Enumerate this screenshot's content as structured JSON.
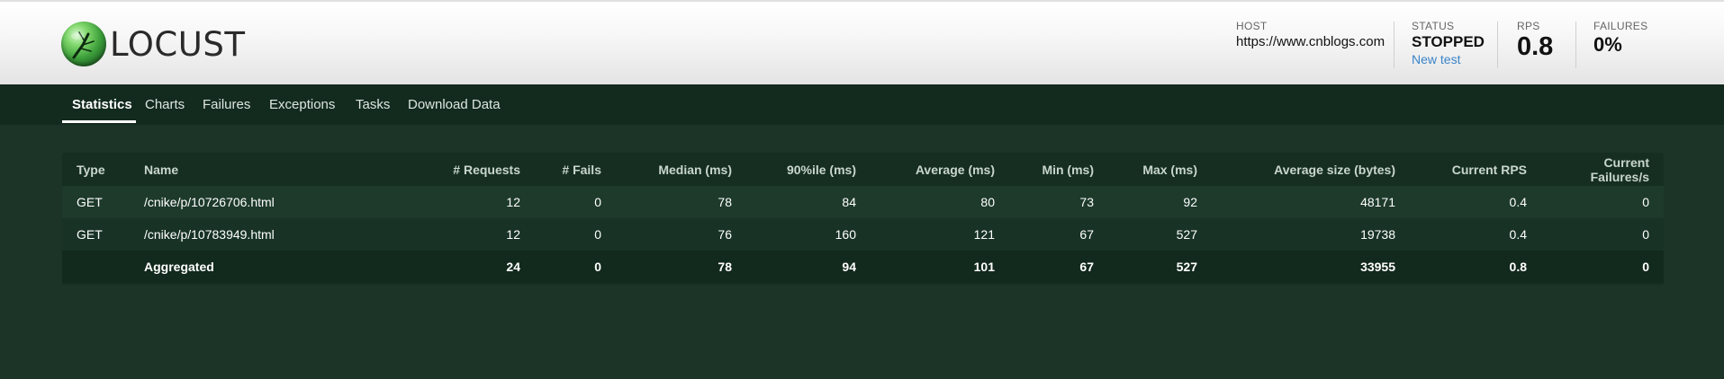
{
  "app": {
    "logo_text": "LOCUST"
  },
  "header": {
    "host_label": "HOST",
    "host_value": "https://www.cnblogs.com",
    "status_label": "STATUS",
    "status_value": "STOPPED",
    "new_test_link": "New test",
    "rps_label": "RPS",
    "rps_value": "0.8",
    "failures_label": "FAILURES",
    "failures_value": "0%"
  },
  "tabs": [
    {
      "label": "Statistics",
      "active": true
    },
    {
      "label": "Charts"
    },
    {
      "label": "Failures"
    },
    {
      "label": "Exceptions"
    },
    {
      "label": "Tasks"
    },
    {
      "label": "Download Data"
    }
  ],
  "table": {
    "columns": [
      "Type",
      "Name",
      "# Requests",
      "# Fails",
      "Median (ms)",
      "90%ile (ms)",
      "Average (ms)",
      "Min (ms)",
      "Max (ms)",
      "Average size (bytes)",
      "Current RPS",
      "Current Failures/s"
    ],
    "rows": [
      [
        "GET",
        "/cnike/p/10726706.html",
        "12",
        "0",
        "78",
        "84",
        "80",
        "73",
        "92",
        "48171",
        "0.4",
        "0"
      ],
      [
        "GET",
        "/cnike/p/10783949.html",
        "12",
        "0",
        "76",
        "160",
        "121",
        "67",
        "527",
        "19738",
        "0.4",
        "0"
      ],
      [
        "",
        "Aggregated",
        "24",
        "0",
        "78",
        "94",
        "101",
        "67",
        "527",
        "33955",
        "0.8",
        "0"
      ]
    ]
  },
  "colors": {
    "background": "#1c3428",
    "nav_background": "#132a1f",
    "link": "#3a84c9"
  }
}
